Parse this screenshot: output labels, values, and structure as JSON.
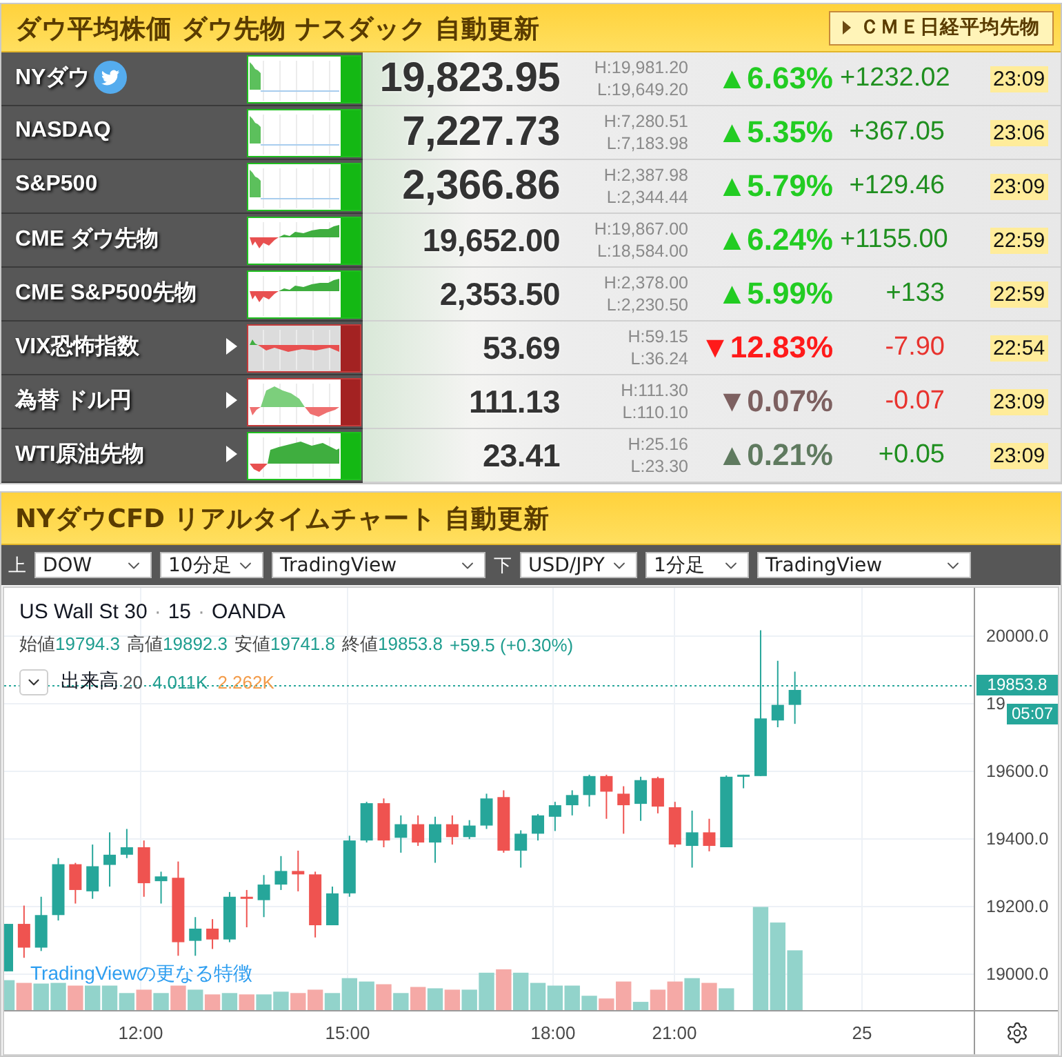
{
  "header": {
    "title": "ダウ平均株価 ダウ先物 ナスダック 自動更新",
    "link_button": "ＣＭＥ日経平均先物"
  },
  "quotes": [
    {
      "kind": "primary",
      "name": "NYダウ",
      "social_icon": true,
      "expandable": false,
      "value": "19,823.95",
      "high": "H:19,981.20",
      "low": "L:19,649.20",
      "rising": true,
      "change_pct": "▲6.63%",
      "color": "#22cc22",
      "change": "+1232.02",
      "time": "23:09"
    },
    {
      "kind": "primary",
      "name": "NASDAQ",
      "social_icon": false,
      "expandable": false,
      "value": "7,227.73",
      "high": "H:7,280.51",
      "low": "L:7,183.98",
      "rising": true,
      "change_pct": "▲5.35%",
      "color": "#22cc22",
      "change": "+367.05",
      "time": "23:06"
    },
    {
      "kind": "primary",
      "name": "S&P500",
      "social_icon": false,
      "expandable": false,
      "value": "2,366.86",
      "high": "H:2,387.98",
      "low": "L:2,344.44",
      "rising": true,
      "change_pct": "▲5.79%",
      "color": "#22cc22",
      "change": "+129.46",
      "time": "23:09"
    },
    {
      "kind": "secondary",
      "name": "CME ダウ先物",
      "social_icon": false,
      "expandable": false,
      "value": "19,652.00",
      "high": "H:19,867.00",
      "low": "L:18,584.00",
      "rising": true,
      "change_pct": "▲6.24%",
      "color": "#22cc22",
      "change": "+1155.00",
      "time": "22:59"
    },
    {
      "kind": "secondary",
      "name": "CME S&P500先物",
      "social_icon": false,
      "expandable": false,
      "value": "2,353.50",
      "high": "H:2,378.00",
      "low": "L:2,230.50",
      "rising": true,
      "change_pct": "▲5.99%",
      "color": "#22cc22",
      "change": "+133",
      "time": "22:59"
    },
    {
      "kind": "secondary",
      "name": "VIX恐怖指数",
      "social_icon": false,
      "expandable": true,
      "value": "53.69",
      "high": "H:59.15",
      "low": "L:36.24",
      "rising": false,
      "change_pct": "▼12.83%",
      "color": "#ff1a1a",
      "change": "-7.90",
      "time": "22:54"
    },
    {
      "kind": "secondary",
      "name": "為替 ドル円",
      "social_icon": false,
      "expandable": true,
      "value": "111.13",
      "high": "H:111.30",
      "low": "L:110.10",
      "rising": false,
      "change_pct": "▼0.07%",
      "color": "#7d6060",
      "change": "-0.07",
      "time": "23:09"
    },
    {
      "kind": "secondary",
      "name": "WTI原油先物",
      "social_icon": false,
      "expandable": true,
      "value": "23.41",
      "high": "H:25.16",
      "low": "L:23.30",
      "rising": true,
      "change_pct": "▲0.21%",
      "color": "#5f7a5f",
      "change": "+0.05",
      "time": "23:09"
    }
  ],
  "chart_panel": {
    "title": "NYダウCFD リアルタイムチャート 自動更新",
    "controls": [
      {
        "kind": "label",
        "text": "上"
      },
      {
        "kind": "symbol",
        "value": "DOW"
      },
      {
        "kind": "interval",
        "value": "10分足"
      },
      {
        "kind": "source",
        "value": "TradingView"
      },
      {
        "kind": "label",
        "text": "下"
      },
      {
        "kind": "symbol",
        "value": "USD/JPY"
      },
      {
        "kind": "interval",
        "value": "1分足"
      },
      {
        "kind": "source",
        "value": "TradingView"
      }
    ],
    "chart": {
      "title_parts": [
        {
          "kind": "name",
          "text": "US Wall St 30"
        },
        {
          "kind": "separator",
          "text": "·"
        },
        {
          "kind": "name",
          "text": "15"
        },
        {
          "kind": "separator",
          "text": "·"
        },
        {
          "kind": "name",
          "text": "OANDA"
        }
      ],
      "ohlc": [
        {
          "label": "始値",
          "value": "19794.3"
        },
        {
          "label": "高値",
          "value": "19892.3"
        },
        {
          "label": "安値",
          "value": "19741.8"
        },
        {
          "label": "終値",
          "value": "19853.8"
        }
      ],
      "change": "+59.5 (+0.30%)",
      "volume": {
        "label": "出来高",
        "period": "20",
        "up_value": "4.011K",
        "down_value": "2.262K"
      },
      "promo_link": "TradingViewの更なる特徴",
      "price_ticks": [
        "20000.0",
        "19",
        "19600.0",
        "19400.0",
        "19200.0",
        "19000.0"
      ],
      "last_price": "19853.8",
      "countdown": "05:07",
      "time_ticks": [
        "12:00",
        "15:00",
        "18:00",
        "21:00",
        "25"
      ]
    }
  }
}
